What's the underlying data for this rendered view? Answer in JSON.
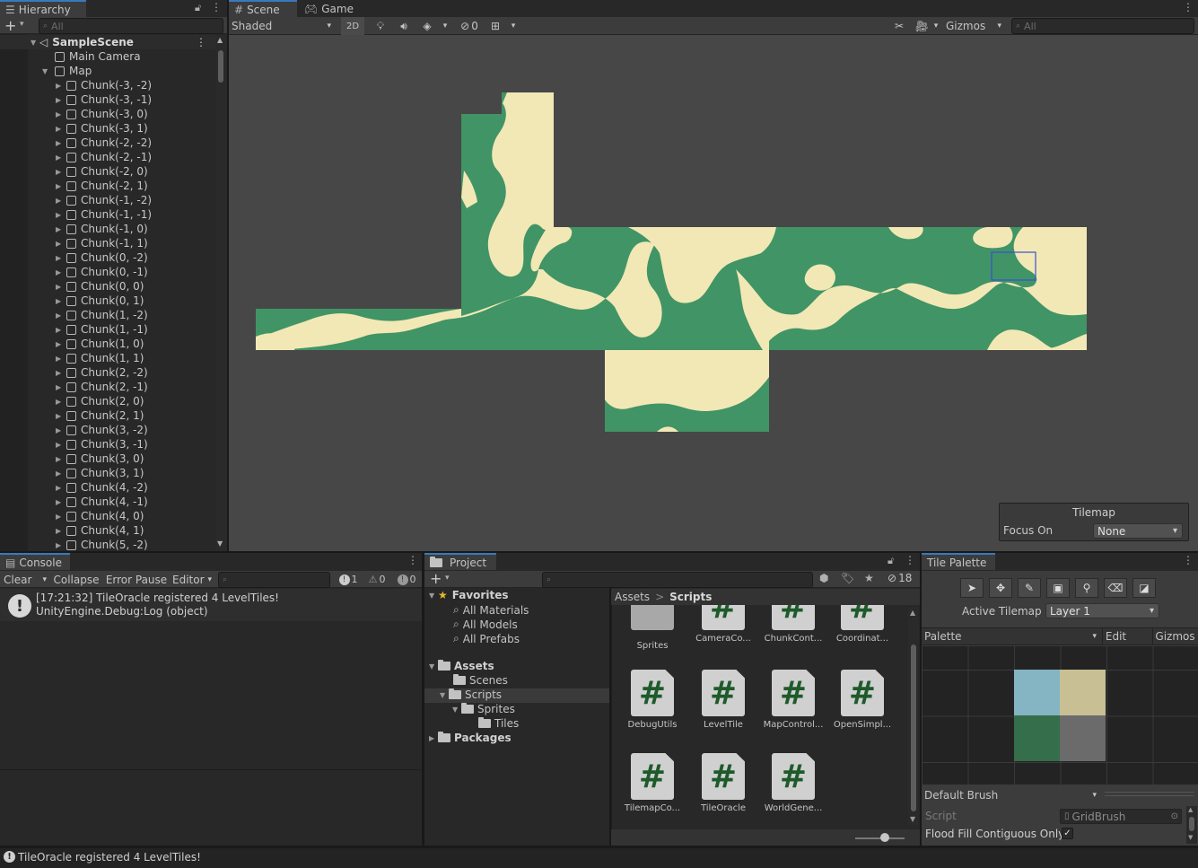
{
  "hierarchy": {
    "tab": "Hierarchy",
    "search_placeholder": "All",
    "scene": "SampleScene",
    "main_camera": "Main Camera",
    "map": "Map",
    "chunks": [
      "Chunk(-3, -2)",
      "Chunk(-3, -1)",
      "Chunk(-3, 0)",
      "Chunk(-3, 1)",
      "Chunk(-2, -2)",
      "Chunk(-2, -1)",
      "Chunk(-2, 0)",
      "Chunk(-2, 1)",
      "Chunk(-1, -2)",
      "Chunk(-1, -1)",
      "Chunk(-1, 0)",
      "Chunk(-1, 1)",
      "Chunk(0, -2)",
      "Chunk(0, -1)",
      "Chunk(0, 0)",
      "Chunk(0, 1)",
      "Chunk(1, -2)",
      "Chunk(1, -1)",
      "Chunk(1, 0)",
      "Chunk(1, 1)",
      "Chunk(2, -2)",
      "Chunk(2, -1)",
      "Chunk(2, 0)",
      "Chunk(2, 1)",
      "Chunk(3, -2)",
      "Chunk(3, -1)",
      "Chunk(3, 0)",
      "Chunk(3, 1)",
      "Chunk(4, -2)",
      "Chunk(4, -1)",
      "Chunk(4, 0)",
      "Chunk(4, 1)",
      "Chunk(5, -2)"
    ]
  },
  "scene_view": {
    "tabs": [
      "Scene",
      "Game"
    ],
    "shading": "Shaded",
    "mode_2d": "2D",
    "hidden_count": "0",
    "gizmos": "Gizmos",
    "search_placeholder": "All",
    "colors": {
      "land": "#419465",
      "sand": "#f2e8b5",
      "bg": "#474747"
    },
    "overlay": {
      "title": "Tilemap",
      "focus_label": "Focus On",
      "focus_value": "None"
    }
  },
  "console": {
    "tab": "Console",
    "clear": "Clear",
    "collapse": "Collapse",
    "error_pause": "Error Pause",
    "editor": "Editor",
    "count_log": "1",
    "count_warn": "0",
    "count_error": "0",
    "message_line1": "[17:21:32] TileOracle registered 4 LevelTiles!",
    "message_line2": "UnityEngine.Debug:Log (object)"
  },
  "project": {
    "tab": "Project",
    "hidden_count": "18",
    "favorites": "Favorites",
    "fav_items": [
      "All Materials",
      "All Models",
      "All Prefabs"
    ],
    "assets": "Assets",
    "scenes": "Scenes",
    "scripts": "Scripts",
    "sprites": "Sprites",
    "tiles": "Tiles",
    "packages": "Packages",
    "breadcrumb_root": "Assets",
    "breadcrumb_sep": ">",
    "breadcrumb_leaf": "Scripts",
    "row1": [
      "Sprites",
      "CameraCo...",
      "ChunkCont...",
      "Coordinat..."
    ],
    "row2": [
      "DebugUtils",
      "LevelTile",
      "MapControl...",
      "OpenSimpl..."
    ],
    "row3": [
      "TilemapCo...",
      "TileOracle",
      "WorldGene..."
    ]
  },
  "tile_palette": {
    "tab": "Tile Palette",
    "active_tilemap_label": "Active Tilemap",
    "active_tilemap_value": "Layer 1",
    "palette": "Palette",
    "edit": "Edit",
    "gizmos": "Gizmos",
    "brush": "Default Brush",
    "script_label": "Script",
    "script_value": "GridBrush",
    "flood_fill_label": "Flood Fill Contiguous Only",
    "tile_colors": [
      "#85b4c3",
      "#c8bf94",
      "#356e4a",
      "#6b6b6b"
    ]
  },
  "status_bar": {
    "message": "TileOracle registered 4 LevelTiles!"
  }
}
